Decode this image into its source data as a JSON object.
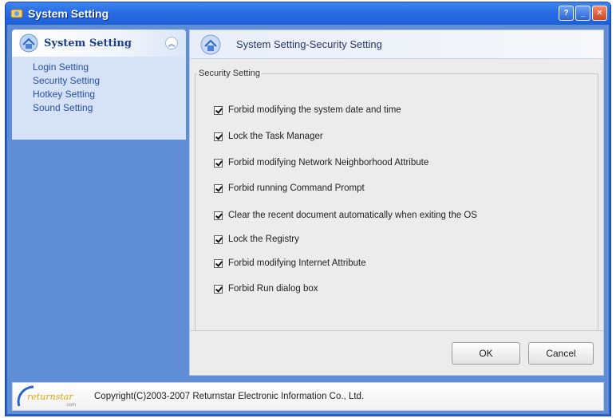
{
  "window": {
    "title": "System Setting",
    "title_icon": "app-icon",
    "buttons": [
      "help-icon",
      "minimize-icon",
      "close-icon"
    ]
  },
  "sidebar": {
    "group_title": "System Setting",
    "group_icon": "system-setting-icon",
    "collapse_icon": "collapse-up-icon",
    "items": [
      {
        "label": "Login Setting"
      },
      {
        "label": "Security Setting"
      },
      {
        "label": "Hotkey Setting"
      },
      {
        "label": "Sound Setting"
      }
    ]
  },
  "panel": {
    "title": "System Setting-Security Setting",
    "icon": "system-setting-icon",
    "group_label": "Security Setting",
    "options": [
      {
        "label": "Forbid modifying the system date and time",
        "checked": true
      },
      {
        "label": "Lock the Task Manager",
        "checked": true
      },
      {
        "label": "Forbid modifying Network Neighborhood Attribute",
        "checked": true
      },
      {
        "label": "Forbid running Command Prompt",
        "checked": true
      },
      {
        "label": "Clear the recent document automatically when exiting the OS",
        "checked": true
      },
      {
        "label": "Lock the Registry",
        "checked": true
      },
      {
        "label": "Forbid modifying Internet Attribute",
        "checked": true
      },
      {
        "label": "Forbid Run dialog box",
        "checked": true
      }
    ]
  },
  "buttons": {
    "ok": "OK",
    "cancel": "Cancel"
  },
  "footer": {
    "logo_icon": "returnstar-logo-icon",
    "copyright": "Copyright(C)2003-2007 Returnstar Electronic Information Co., Ltd."
  }
}
